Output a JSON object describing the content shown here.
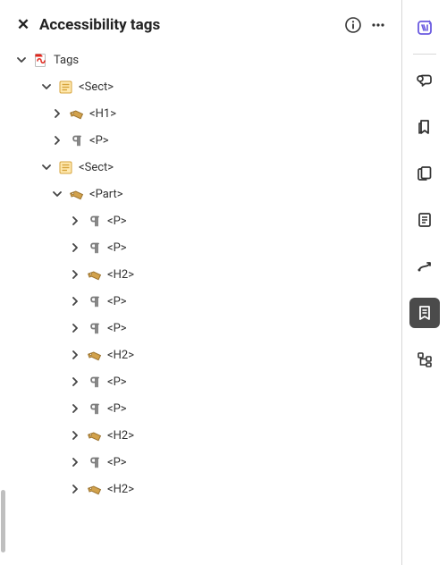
{
  "header": {
    "title": "Accessibility tags",
    "close_glyph": "✕",
    "info_tooltip": "Info",
    "more_tooltip": "More options"
  },
  "tree": {
    "root_label": "Tags",
    "nodes": [
      {
        "depth": 0,
        "expanded": true,
        "icon": "pdf",
        "label_key": "root_label"
      },
      {
        "depth": 1,
        "expanded": true,
        "icon": "section",
        "text": "<Sect>"
      },
      {
        "depth": 2,
        "expanded": false,
        "icon": "tag",
        "text": "<H1>"
      },
      {
        "depth": 2,
        "expanded": false,
        "icon": "paragraph",
        "text": "<P>"
      },
      {
        "depth": 1,
        "expanded": true,
        "icon": "section",
        "text": "<Sect>"
      },
      {
        "depth": 2,
        "expanded": true,
        "icon": "tag",
        "text": "<Part>"
      },
      {
        "depth": 3,
        "expanded": false,
        "icon": "paragraph",
        "text": "<P>"
      },
      {
        "depth": 3,
        "expanded": false,
        "icon": "paragraph",
        "text": "<P>"
      },
      {
        "depth": 3,
        "expanded": false,
        "icon": "tag",
        "text": "<H2>"
      },
      {
        "depth": 3,
        "expanded": false,
        "icon": "paragraph",
        "text": "<P>"
      },
      {
        "depth": 3,
        "expanded": false,
        "icon": "paragraph",
        "text": "<P>"
      },
      {
        "depth": 3,
        "expanded": false,
        "icon": "tag",
        "text": "<H2>"
      },
      {
        "depth": 3,
        "expanded": false,
        "icon": "paragraph",
        "text": "<P>"
      },
      {
        "depth": 3,
        "expanded": false,
        "icon": "paragraph",
        "text": "<P>"
      },
      {
        "depth": 3,
        "expanded": false,
        "icon": "tag",
        "text": "<H2>"
      },
      {
        "depth": 3,
        "expanded": false,
        "icon": "paragraph",
        "text": "<P>"
      },
      {
        "depth": 3,
        "expanded": false,
        "icon": "tag",
        "text": "<H2>"
      }
    ]
  },
  "rail": {
    "items": [
      {
        "name": "ai-assistant",
        "active": false,
        "accent": "#6a5ae0"
      },
      {
        "name": "comments",
        "active": false
      },
      {
        "name": "bookmarks",
        "active": false
      },
      {
        "name": "pages",
        "active": false
      },
      {
        "name": "content",
        "active": false
      },
      {
        "name": "order",
        "active": false
      },
      {
        "name": "tags",
        "active": true
      },
      {
        "name": "structure",
        "active": false
      }
    ]
  },
  "icons": {
    "colors": {
      "tag_fill": "#d2a24c",
      "tag_stroke": "#9c7430",
      "paragraph": "#7a7a7a",
      "section_bg": "#ffe9b0",
      "section_border": "#d6a33a",
      "pdf_red": "#e1261c"
    }
  }
}
